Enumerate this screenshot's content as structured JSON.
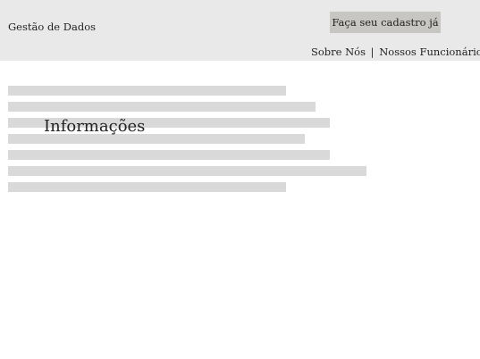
{
  "header": {
    "brand": "Gestão de Dados",
    "signup_label": "Faça seu cadastro já",
    "nav": {
      "about": "Sobre Nós",
      "separator": "|",
      "employees": "Nossos Funcionários"
    }
  },
  "main": {
    "title": "Informações",
    "placeholder_line_count": 7
  },
  "colors": {
    "header_background": "#e9e9e9",
    "button_background": "#c7c6c2",
    "placeholder_bar": "#d9d9d9",
    "text": "#222222"
  }
}
